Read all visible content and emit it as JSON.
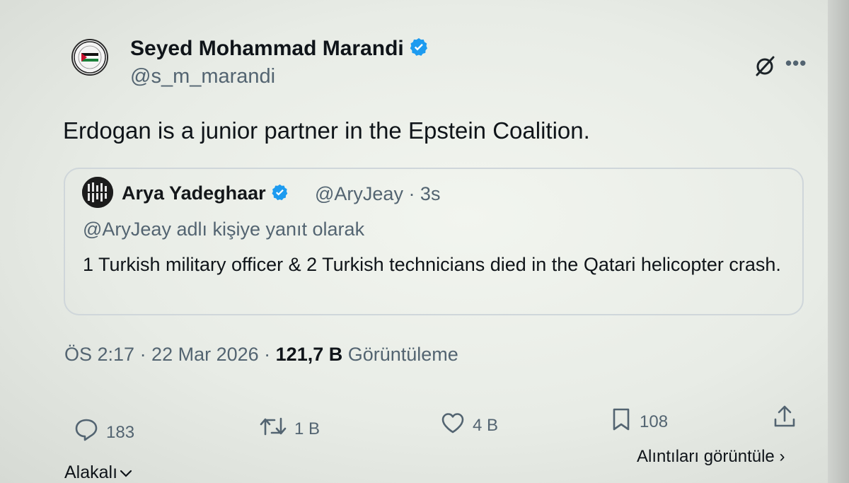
{
  "author": {
    "display_name": "Seyed Mohammad Marandi",
    "handle": "@s_m_marandi",
    "verified": true
  },
  "tweet": {
    "text": "Erdogan is a junior partner in the Epstein Coalition."
  },
  "quoted_tweet": {
    "display_name": "Arya Yadeghaar",
    "handle_and_time": "@AryJeay · 3s",
    "reply_to": "@AryJeay adlı kişiye yanıt olarak",
    "text": "1 Turkish military officer & 2 Turkish technicians died in the Qatari helicopter crash."
  },
  "meta": {
    "time_date": "ÖS 2:17 · 22 Mar 2026 · ",
    "views_count": "121,7 B",
    "views_label": " Görüntüleme"
  },
  "actions": {
    "replies": "183",
    "reposts": "1 B",
    "likes": "4 B",
    "bookmarks": "108"
  },
  "links": {
    "view_quotes": "Alıntıları görüntüle ›",
    "related": "Alakalı"
  },
  "colors": {
    "verified_blue": "#1d9bf0",
    "muted_text": "#536471",
    "primary_text": "#0f1419"
  },
  "icons": [
    "grok-icon",
    "more-icon",
    "reply-icon",
    "repost-icon",
    "like-icon",
    "bookmark-icon",
    "share-icon",
    "chevron-down-icon"
  ]
}
